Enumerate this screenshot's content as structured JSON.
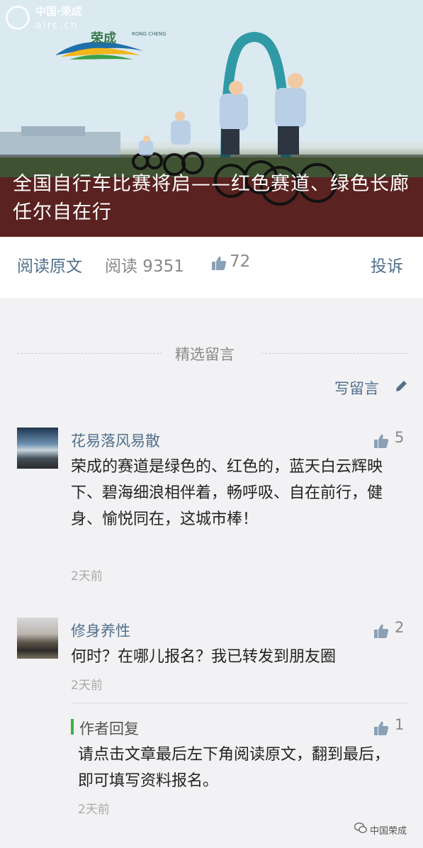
{
  "hero": {
    "title": "全国自行车比赛将启——红色赛道、绿色长廊任尔自在行",
    "watermark_line1": "中国·荣成",
    "watermark_line2": "airc.cn",
    "brand_name": "荣成",
    "brand_sub": "RONG CHENG"
  },
  "read_bar": {
    "read_original": "阅读原文",
    "read_count": "阅读 9351",
    "like_count": "72",
    "report": "投诉"
  },
  "comments_section": {
    "title": "精选留言",
    "write_label": "写留言"
  },
  "comments": [
    {
      "nickname": "花易落风易散",
      "text": "荣成的赛道是绿色的、红色的，蓝天白云辉映下、碧海细浪相伴着，畅呼吸、自在前行，健身、愉悦同在，这城市棒！",
      "time": "2天前",
      "likes": "5"
    },
    {
      "nickname": "修身养性",
      "text": "何时？在哪儿报名？我已转发到朋友圈",
      "time": "2天前",
      "likes": "2",
      "reply": {
        "label": "作者回复",
        "text": "请点击文章最后左下角阅读原文，翻到最后，即可填写资料报名。",
        "time": "2天前",
        "likes": "1"
      }
    }
  ],
  "footer": {
    "text": "中国荣成"
  },
  "colors": {
    "link": "#52708c",
    "reply_accent": "#3cb046",
    "background": "#f2f2f4"
  }
}
